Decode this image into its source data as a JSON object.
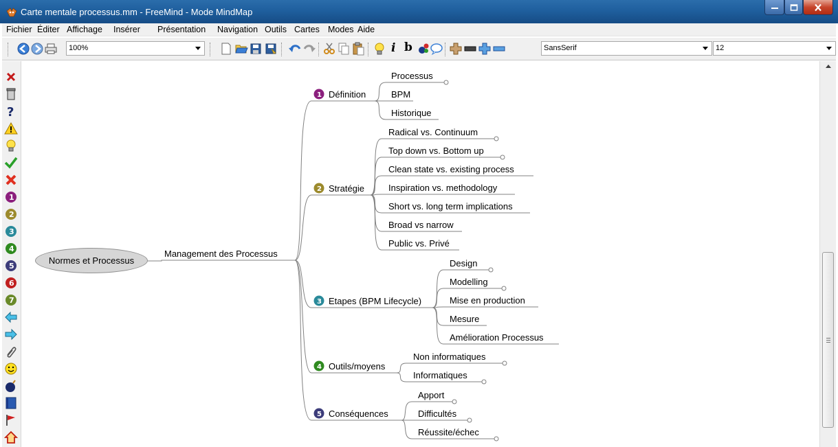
{
  "window": {
    "title": "Carte mentale processus.mm - FreeMind - Mode MindMap",
    "controls": [
      "minimize-icon",
      "maximize-icon",
      "close-icon"
    ]
  },
  "menu": [
    "Fichier",
    "Éditer",
    "Affichage",
    "Insérer",
    "Présentation",
    "Navigation",
    "Outils",
    "Cartes",
    "Modes",
    "Aide"
  ],
  "toolbar": {
    "zoom": "100%",
    "font_family": "SansSerif",
    "font_size": "12",
    "icons": [
      "back-icon",
      "forward-icon",
      "print-icon",
      "new-icon",
      "open-icon",
      "save-icon",
      "save-as-icon",
      "undo-icon",
      "redo-icon",
      "cut-icon",
      "copy-icon",
      "paste-icon",
      "idea-icon",
      "italic-icon",
      "bold-icon",
      "node-color-icon",
      "cloud-icon",
      "add-icon",
      "remove-icon",
      "add-small-icon",
      "remove-small-icon"
    ],
    "italic_glyph": "i",
    "bold_glyph": "b"
  },
  "left_icons": [
    "close-red-icon",
    "trash-icon",
    "question-icon",
    "warning-icon",
    "bulb-icon",
    "check-icon",
    "cross-icon",
    "priority-1-icon",
    "priority-2-icon",
    "priority-3-icon",
    "priority-4-icon",
    "priority-5-icon",
    "priority-6-icon",
    "priority-7-icon",
    "arrow-left-icon",
    "arrow-right-icon",
    "paperclip-icon",
    "smiley-icon",
    "bomb-icon",
    "book-icon",
    "flag-icon",
    "home-icon"
  ],
  "colors": {
    "title_bar": "#1f5f9e",
    "edge": "#808080",
    "badge_1": "#8b1f7d",
    "badge_2": "#9c8a2c",
    "badge_3": "#2a8a9a",
    "badge_4": "#2f8a1f",
    "badge_5": "#3c3c7a"
  },
  "map": {
    "root": "Normes et Processus",
    "main": "Management des Processus",
    "branches": [
      {
        "badge": "1",
        "label": "Définition",
        "children": [
          "Processus",
          "BPM",
          "Historique"
        ]
      },
      {
        "badge": "2",
        "label": "Stratégie",
        "children": [
          "Radical vs. Continuum",
          "Top down vs. Bottom up",
          "Clean state vs. existing process",
          "Inspiration vs. methodology",
          "Short vs. long term implications",
          "Broad vs narrow",
          "Public vs. Privé"
        ]
      },
      {
        "badge": "3",
        "label": "Etapes (BPM Lifecycle)",
        "children": [
          "Design",
          "Modelling",
          "Mise en production",
          "Mesure",
          "Amélioration Processus"
        ]
      },
      {
        "badge": "4",
        "label": "Outils/moyens",
        "children": [
          "Non informatiques",
          "Informatiques"
        ]
      },
      {
        "badge": "5",
        "label": "Conséquences",
        "children": [
          "Apport",
          "Difficultés",
          "Réussite/échec"
        ]
      }
    ]
  }
}
